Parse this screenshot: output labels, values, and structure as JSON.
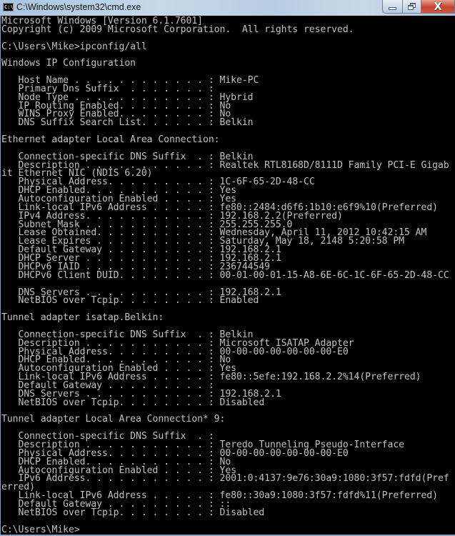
{
  "window": {
    "title": "C:\\Windows\\system32\\cmd.exe",
    "app_icon_text": "C:\\",
    "buttons": {
      "minimize": "minimize",
      "maximize": "restore",
      "close": "X"
    },
    "colors": {
      "console_background": "#000000",
      "console_text": "#c0c0c0",
      "close_button": "#c4452e",
      "titlebar": "#b7cde2"
    }
  },
  "console": {
    "lines": [
      "Microsoft Windows [Version 6.1.7601]",
      "Copyright (c) 2009 Microsoft Corporation.  All rights reserved.",
      "",
      "C:\\Users\\Mike>ipconfig/all",
      "",
      "Windows IP Configuration",
      "",
      "   Host Name . . . . . . . . . . . . : Mike-PC",
      "   Primary Dns Suffix  . . . . . . . :",
      "   Node Type . . . . . . . . . . . . : Hybrid",
      "   IP Routing Enabled. . . . . . . . : No",
      "   WINS Proxy Enabled. . . . . . . . : No",
      "   DNS Suffix Search List. . . . . . : Belkin",
      "",
      "Ethernet adapter Local Area Connection:",
      "",
      "   Connection-specific DNS Suffix  . : Belkin",
      "   Description . . . . . . . . . . . : Realtek RTL8168D/8111D Family PCI-E Gigab",
      "it Ethernet NIC (NDIS 6.20)",
      "   Physical Address. . . . . . . . . : 1C-6F-65-2D-48-CC",
      "   DHCP Enabled. . . . . . . . . . . : Yes",
      "   Autoconfiguration Enabled . . . . : Yes",
      "   Link-local IPv6 Address . . . . . : fe80::2484:d6f6:1b10:e6f9%10(Preferred)",
      "   IPv4 Address. . . . . . . . . . . : 192.168.2.2(Preferred)",
      "   Subnet Mask . . . . . . . . . . . : 255.255.255.0",
      "   Lease Obtained. . . . . . . . . . : Wednesday, April 11, 2012 10:42:15 AM",
      "   Lease Expires . . . . . . . . . . : Saturday, May 18, 2148 5:20:58 PM",
      "   Default Gateway . . . . . . . . . : 192.168.2.1",
      "   DHCP Server . . . . . . . . . . . : 192.168.2.1",
      "   DHCPv6 IAID . . . . . . . . . . . : 236744549",
      "   DHCPv6 Client DUID. . . . . . . . : 00-01-00-01-15-A8-6E-6C-1C-6F-65-2D-48-CC",
      "",
      "   DNS Servers . . . . . . . . . . . : 192.168.2.1",
      "   NetBIOS over Tcpip. . . . . . . . : Enabled",
      "",
      "Tunnel adapter isatap.Belkin:",
      "",
      "   Connection-specific DNS Suffix  . : Belkin",
      "   Description . . . . . . . . . . . : Microsoft ISATAP Adapter",
      "   Physical Address. . . . . . . . . : 00-00-00-00-00-00-00-E0",
      "   DHCP Enabled. . . . . . . . . . . : No",
      "   Autoconfiguration Enabled . . . . : Yes",
      "   Link-local IPv6 Address . . . . . : fe80::5efe:192.168.2.2%14(Preferred)",
      "   Default Gateway . . . . . . . . . :",
      "   DNS Servers . . . . . . . . . . . : 192.168.2.1",
      "   NetBIOS over Tcpip. . . . . . . . : Disabled",
      "",
      "Tunnel adapter Local Area Connection* 9:",
      "",
      "   Connection-specific DNS Suffix  . :",
      "   Description . . . . . . . . . . . : Teredo Tunneling Pseudo-Interface",
      "   Physical Address. . . . . . . . . : 00-00-00-00-00-00-00-E0",
      "   DHCP Enabled. . . . . . . . . . . : No",
      "   Autoconfiguration Enabled . . . . : Yes",
      "   IPv6 Address. . . . . . . . . . . : 2001:0:4137:9e76:30a9:1080:3f57:fdfd(Pref",
      "erred)",
      "   Link-local IPv6 Address . . . . . : fe80::30a9:1080:3f57:fdfd%11(Preferred)",
      "   Default Gateway . . . . . . . . . : ::",
      "   NetBIOS over Tcpip. . . . . . . . : Disabled",
      "",
      "C:\\Users\\Mike>"
    ]
  }
}
